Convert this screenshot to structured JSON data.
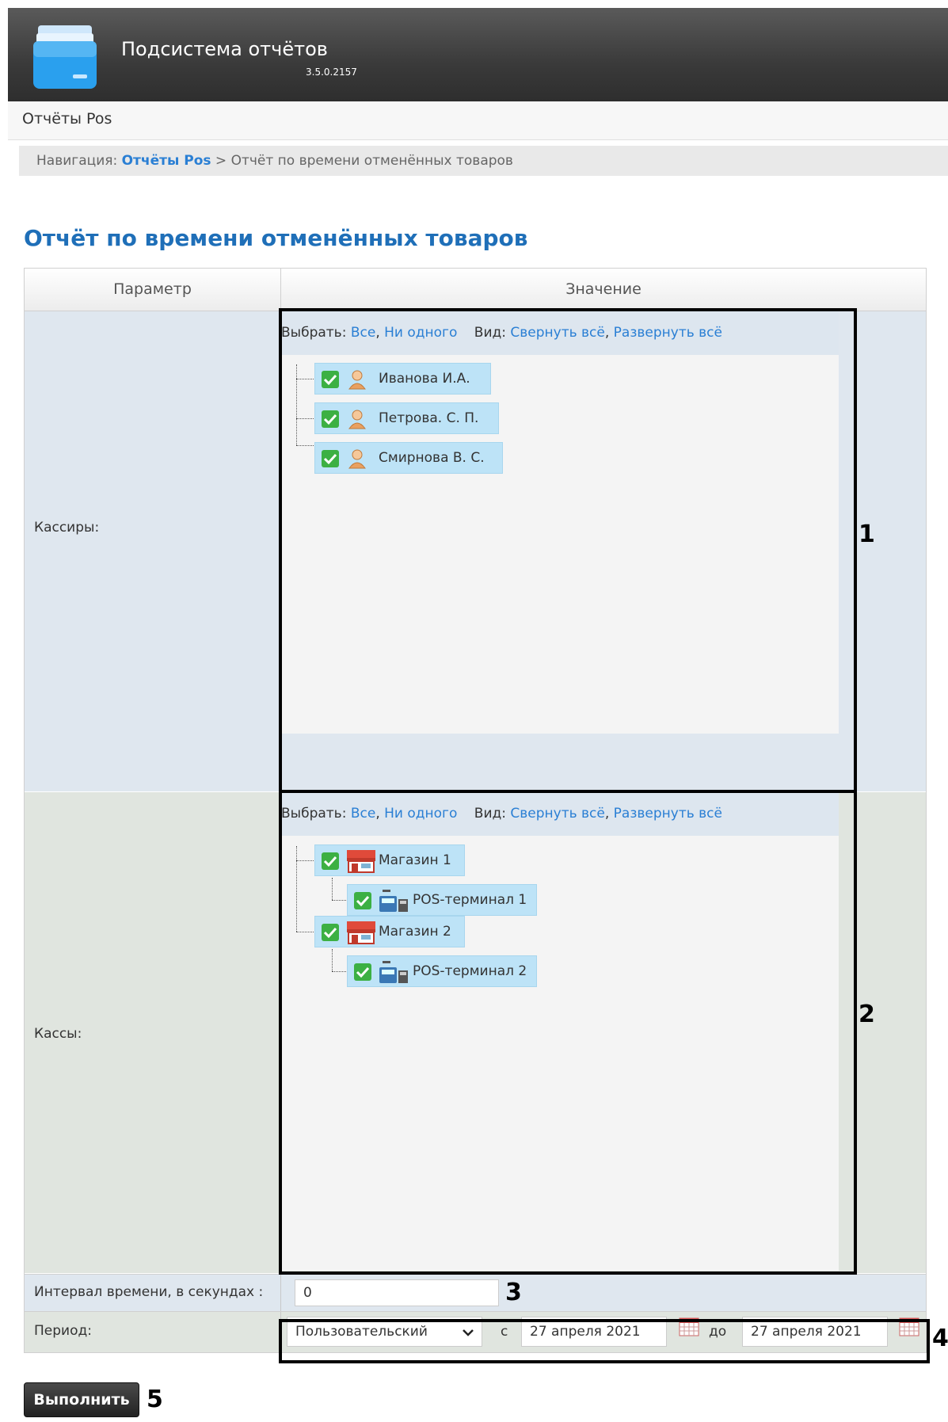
{
  "header": {
    "app_title": "Подсистема отчётов",
    "version": "3.5.0.2157",
    "logo_icon": "folder-icon"
  },
  "menu": {
    "item": "Отчёты Pos"
  },
  "breadcrumb": {
    "prefix": "Навигация: ",
    "link": "Отчёты Pos",
    "separator": " > ",
    "current": "Отчёт по времени отменённых товаров"
  },
  "page_title": "Отчёт по времени отменённых товаров",
  "table": {
    "col_param": "Параметр",
    "col_value": "Значение",
    "cashiers": {
      "label": "Кассиры:",
      "toolbar": {
        "select_label": "Выбрать:",
        "all": "Все",
        "none": "Ни одного",
        "view_label": "Вид:",
        "collapse": "Свернуть всё",
        "expand": "Развернуть всё"
      },
      "items": [
        "Иванова И.А.",
        "Петрова. С. П.",
        "Смирнова В. С."
      ]
    },
    "registers": {
      "label": "Кассы:",
      "toolbar": {
        "select_label": "Выбрать:",
        "all": "Все",
        "none": "Ни одного",
        "view_label": "Вид:",
        "collapse": "Свернуть всё",
        "expand": "Развернуть всё"
      },
      "shops": [
        {
          "name": "Магазин 1",
          "terminal": "POS-терминал 1"
        },
        {
          "name": "Магазин 2",
          "terminal": "POS-терминал 2"
        }
      ]
    },
    "interval": {
      "label": "Интервал времени, в секундах :",
      "value": "0"
    },
    "period": {
      "label": "Период:",
      "selected": "Пользовательский",
      "from_label": "с",
      "from_value": "27 апреля 2021",
      "to_label": "до",
      "to_value": "27 апреля 2021"
    }
  },
  "run_button": "Выполнить",
  "annotations": [
    "1",
    "2",
    "3",
    "4",
    "5"
  ],
  "colors": {
    "link": "#2a7fd4",
    "title": "#1f6fb8",
    "node_bg": "#bde3f7",
    "check": "#3cb043"
  }
}
